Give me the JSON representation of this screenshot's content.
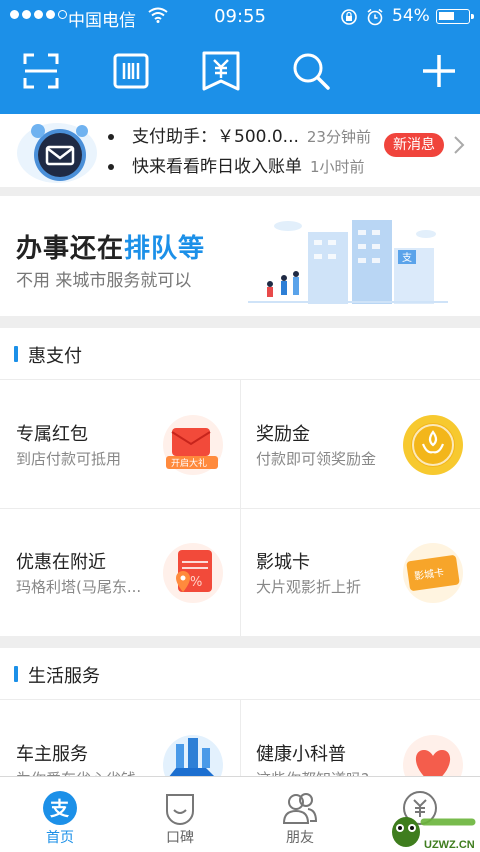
{
  "status_bar": {
    "carrier": "中国电信",
    "time": "09:55",
    "battery_percent": "54%",
    "battery_level": 0.54,
    "signal_bars": 4,
    "icons": [
      "wifi-icon",
      "rotation-lock-icon",
      "alarm-icon",
      "battery-icon"
    ]
  },
  "toolbar": {
    "icons": [
      "scan-icon",
      "barcode-pay-icon",
      "collect-money-icon",
      "search-icon",
      "add-icon"
    ]
  },
  "notification": {
    "items": [
      {
        "text": "支付助手：￥500.0...",
        "time": "23分钟前"
      },
      {
        "text": "快来看看昨日收入账单",
        "time": "1小时前"
      }
    ],
    "badge": "新消息"
  },
  "banner": {
    "title_prefix": "办事还在",
    "title_highlight": "排队等",
    "subtitle": "不用  来城市服务就可以"
  },
  "sections": [
    {
      "title": "惠支付",
      "cards": [
        {
          "title": "专属红包",
          "subtitle": "到店付款可抵用",
          "icon": "red-envelope-icon",
          "icon_text": "开启大礼"
        },
        {
          "title": "奖励金",
          "subtitle": "付款即可领奖励金",
          "icon": "gold-coin-icon",
          "icon_text": ""
        },
        {
          "title": "优惠在附近",
          "subtitle": "玛格利塔(马尾东...",
          "icon": "coupon-icon",
          "icon_text": ""
        },
        {
          "title": "影城卡",
          "subtitle": "大片观影折上折",
          "icon": "cinema-card-icon",
          "icon_text": "影城卡"
        }
      ]
    },
    {
      "title": "生活服务",
      "cards": [
        {
          "title": "车主服务",
          "subtitle": "为你爱车省心省钱",
          "icon": "car-icon"
        },
        {
          "title": "健康小科普",
          "subtitle": "这些你都知道吗?",
          "icon": "heart-icon"
        }
      ]
    }
  ],
  "tabbar": {
    "tabs": [
      {
        "label": "首页",
        "icon": "alipay-home-icon",
        "active": true
      },
      {
        "label": "口碑",
        "icon": "koubei-icon",
        "active": false
      },
      {
        "label": "朋友",
        "icon": "friends-icon",
        "active": false
      },
      {
        "label": "",
        "icon": "wealth-icon",
        "active": false
      }
    ]
  },
  "watermark": {
    "text": "UZWZ.CN"
  },
  "colors": {
    "brand": "#1c90e8",
    "badge": "#f0443c",
    "text": "#222222",
    "muted": "#888888"
  }
}
